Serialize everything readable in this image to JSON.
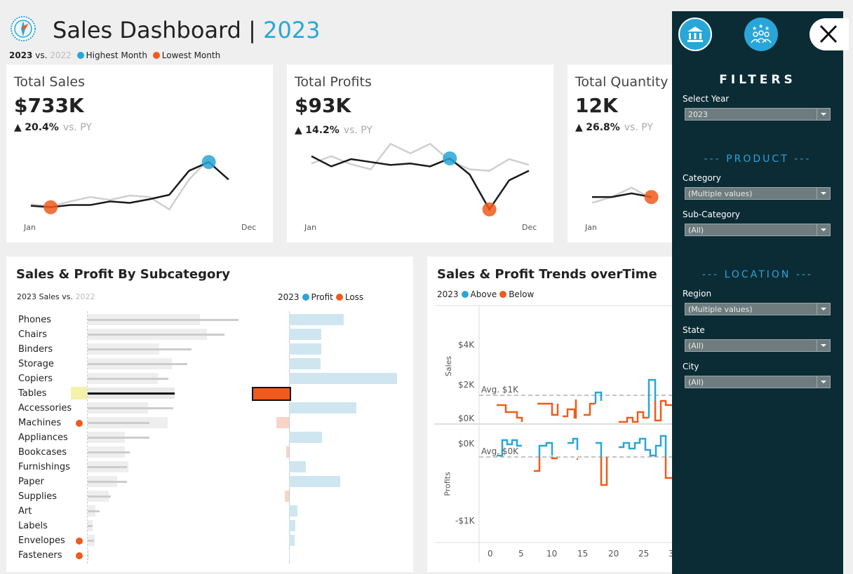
{
  "header": {
    "title": "Sales Dashboard",
    "separator": "|",
    "year": "2023",
    "legend": {
      "current": "2023",
      "vs": "vs.",
      "prior": "2022",
      "highest": "Highest Month",
      "lowest": "Lowest Month"
    }
  },
  "colors": {
    "accent": "#29a6d8",
    "high": "#29a6d8",
    "low": "#f05a1a",
    "panel": "#0b2b35"
  },
  "kpis": [
    {
      "title": "Total Sales",
      "value": "$733K",
      "delta": "20.4%",
      "vs_label": "vs. PY",
      "axis_start": "Jan",
      "axis_end": "Dec",
      "current": [
        0.1,
        0.08,
        0.11,
        0.11,
        0.16,
        0.14,
        0.19,
        0.25,
        0.58,
        0.7,
        0.46
      ],
      "prior": [
        0.12,
        0.09,
        0.16,
        0.22,
        0.18,
        0.24,
        0.22,
        0.05,
        0.46,
        0.74
      ],
      "high_index": 9,
      "low_index": 1
    },
    {
      "title": "Total Profits",
      "value": "$93K",
      "delta": "14.2%",
      "vs_label": "vs. PY",
      "axis_start": "Jan",
      "axis_end": "Dec",
      "current": [
        0.78,
        0.64,
        0.74,
        0.7,
        0.66,
        0.68,
        0.64,
        0.75,
        0.53,
        0.05,
        0.45,
        0.58
      ],
      "prior": [
        0.68,
        0.78,
        0.67,
        0.6,
        0.95,
        0.82,
        0.95,
        0.72,
        0.6,
        0.58,
        0.74,
        0.66
      ],
      "high_index": 7,
      "low_index": 9
    },
    {
      "title": "Total Quantity",
      "value": "12K",
      "delta": "26.8%",
      "vs_label": "vs. PY",
      "axis_start": "Jan",
      "current": [
        0.22,
        0.22,
        0.27,
        0.22
      ],
      "prior": [
        0.14,
        0.22,
        0.35,
        0.2
      ],
      "high_index": -1,
      "low_index": 3
    }
  ],
  "subcategory": {
    "title": "Sales & Profit By Subcategory",
    "sales_legend_current": "2023 Sales",
    "sales_legend_vs": "vs.",
    "sales_legend_prior": "2022",
    "profit_legend_year": "2023",
    "profit_label": "Profit",
    "loss_label": "Loss",
    "rows": [
      {
        "name": "Phones",
        "sales2023": 160,
        "sales2022": 215,
        "profit": 78,
        "loss": false
      },
      {
        "name": "Chairs",
        "sales2023": 170,
        "sales2022": 195,
        "profit": 46,
        "loss": false
      },
      {
        "name": "Binders",
        "sales2023": 102,
        "sales2022": 148,
        "profit": 46,
        "loss": false
      },
      {
        "name": "Storage",
        "sales2023": 120,
        "sales2022": 142,
        "profit": 45,
        "loss": false
      },
      {
        "name": "Copiers",
        "sales2023": 100,
        "sales2022": 115,
        "profit": 154,
        "loss": false
      },
      {
        "name": "Tables",
        "sales2023": 124,
        "sales2022": 124,
        "profit": 52,
        "loss": true
      },
      {
        "name": "Accessories",
        "sales2023": 86,
        "sales2022": 122,
        "profit": 96,
        "loss": false
      },
      {
        "name": "Machines",
        "sales2023": 114,
        "sales2022": 88,
        "profit": 18,
        "loss": true,
        "marker": true
      },
      {
        "name": "Appliances",
        "sales2023": 53,
        "sales2022": 88,
        "profit": 47,
        "loss": false
      },
      {
        "name": "Bookcases",
        "sales2023": 53,
        "sales2022": 60,
        "profit": 4,
        "loss": true
      },
      {
        "name": "Furnishings",
        "sales2023": 58,
        "sales2022": 56,
        "profit": 24,
        "loss": false
      },
      {
        "name": "Paper",
        "sales2023": 42,
        "sales2022": 56,
        "profit": 73,
        "loss": false
      },
      {
        "name": "Supplies",
        "sales2023": 30,
        "sales2022": 33,
        "profit": 6,
        "loss": true
      },
      {
        "name": "Art",
        "sales2023": 11,
        "sales2022": 17,
        "profit": 12,
        "loss": false
      },
      {
        "name": "Labels",
        "sales2023": 7,
        "sales2022": 7,
        "profit": 9,
        "loss": false
      },
      {
        "name": "Envelopes",
        "sales2023": 10,
        "sales2022": 9,
        "profit": 8,
        "loss": false,
        "marker": true
      },
      {
        "name": "Fasteners",
        "sales2023": 2,
        "sales2022": 1,
        "profit": 1,
        "loss": false,
        "marker": true
      }
    ]
  },
  "trends": {
    "title": "Sales & Profit Trends overTime",
    "legend_year": "2023",
    "above_label": "Above",
    "below_label": "Below",
    "sales_axis_label": "Sales",
    "profits_axis_label": "Profits",
    "sales_ticks": [
      "$4K",
      "$2K",
      "$0K"
    ],
    "profit_ticks": [
      "$0K",
      "-$1K"
    ],
    "sales_avg_label": "Avg. $1K",
    "profit_avg_label": "Avg. $0K",
    "x_ticks": [
      "0",
      "5",
      "10",
      "15",
      "20",
      "25",
      "3"
    ]
  },
  "filters": {
    "title": "FILTERS",
    "close_icon": "close-icon",
    "select_year_label": "Select Year",
    "select_year_value": "2023",
    "product_header": "--- PRODUCT ---",
    "category_label": "Category",
    "category_value": "(Multiple values)",
    "subcategory_label": "Sub-Category",
    "subcategory_value": "(All)",
    "location_header": "--- LOCATION ---",
    "region_label": "Region",
    "region_value": "(Multiple values)",
    "state_label": "State",
    "state_value": "(All)",
    "city_label": "City",
    "city_value": "(All)"
  }
}
